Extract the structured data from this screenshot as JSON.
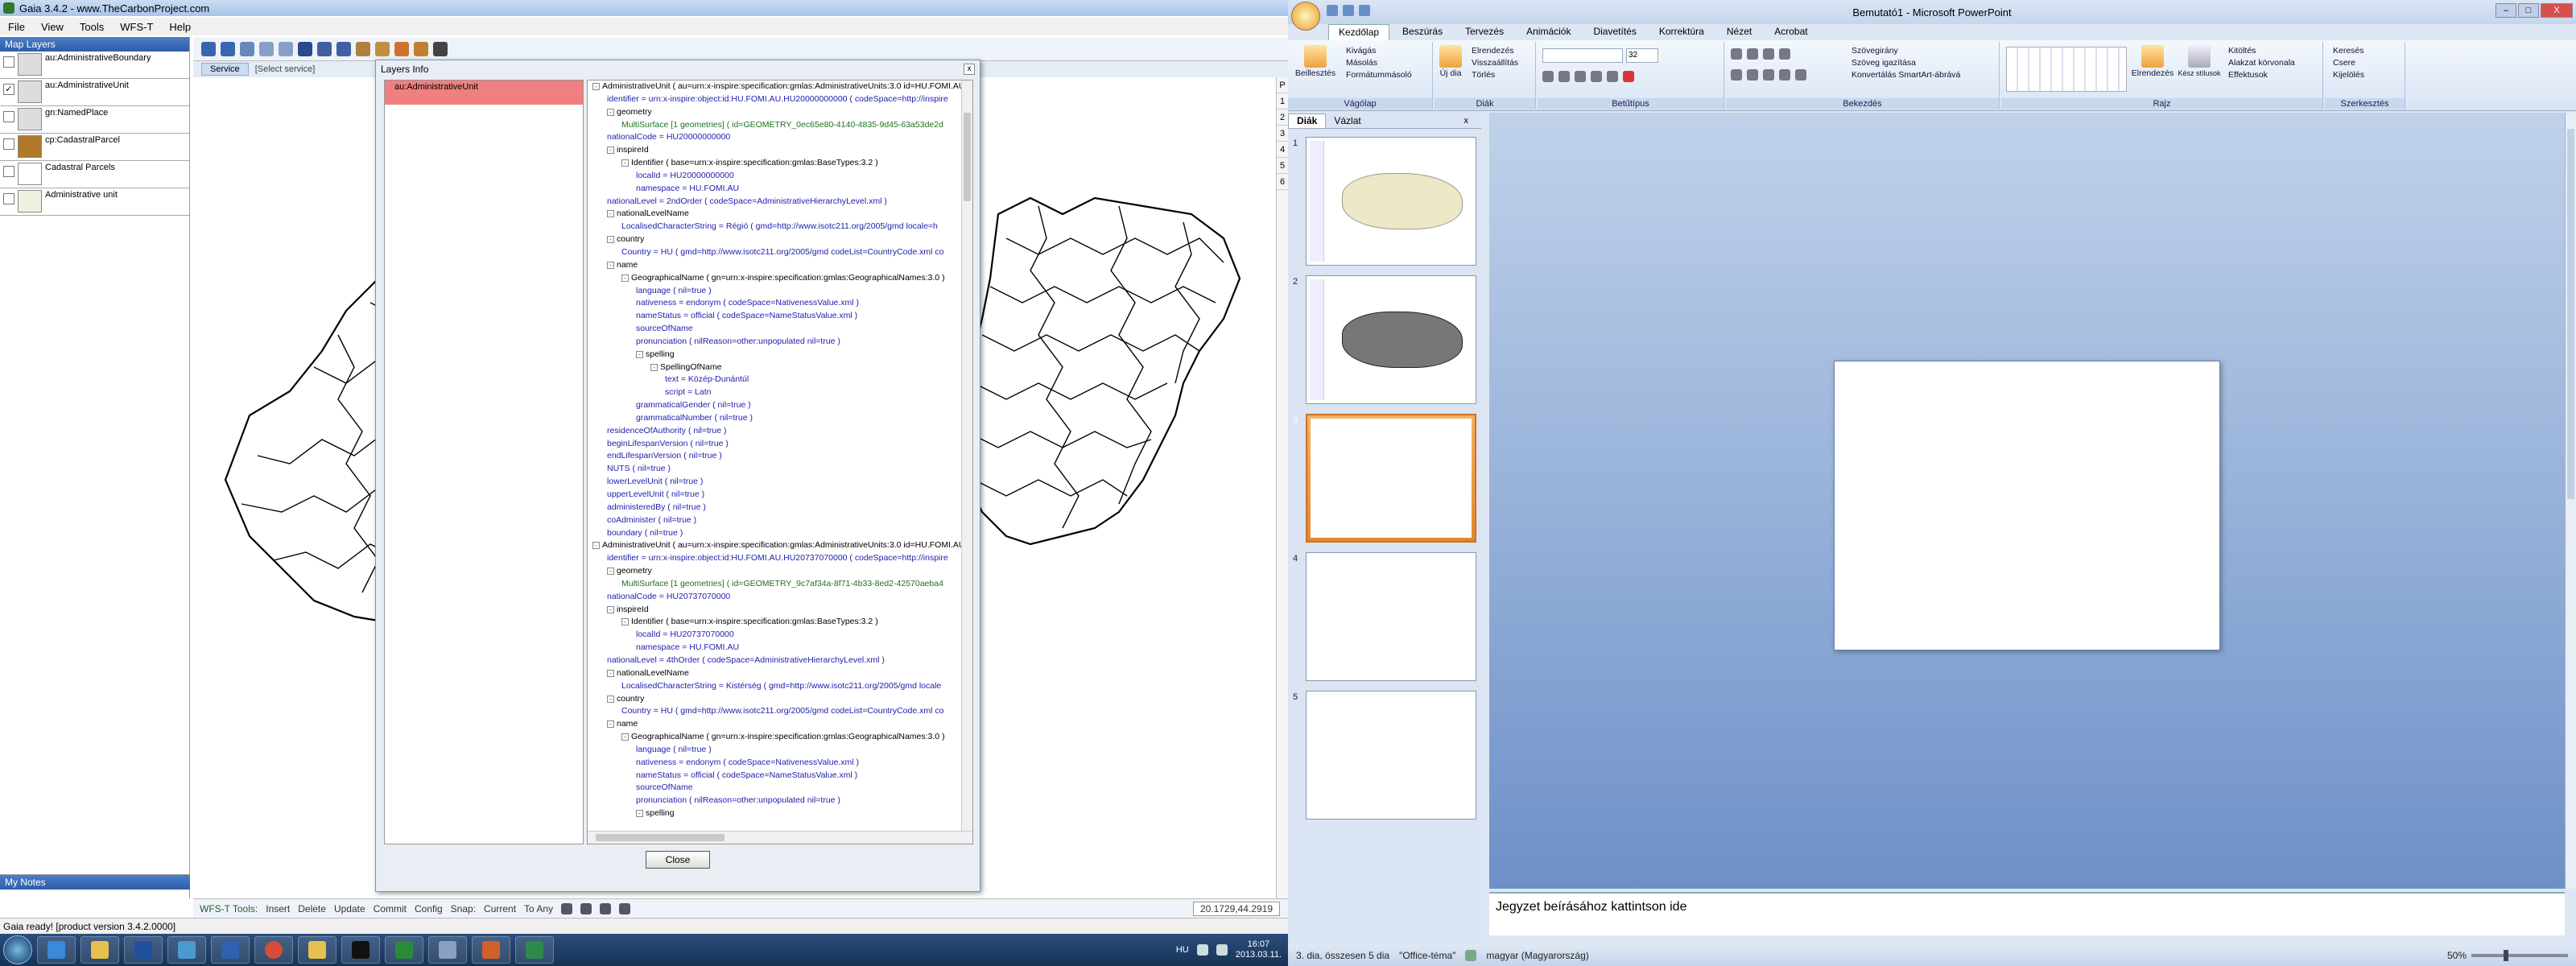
{
  "gaia": {
    "title": "Gaia 3.4.2 - www.TheCarbonProject.com",
    "menu": [
      "File",
      "View",
      "Tools",
      "WFS-T",
      "Help"
    ],
    "map_layers_header": "Map Layers",
    "layers": [
      {
        "name": "au:AdministrativeBoundary",
        "checked": false,
        "swatch": "#dddddd"
      },
      {
        "name": "au:AdministrativeUnit",
        "checked": true,
        "swatch": "#dddddd"
      },
      {
        "name": "gn:NamedPlace",
        "checked": false,
        "swatch": "#dddddd"
      },
      {
        "name": "cp:CadastralParcel",
        "checked": false,
        "swatch": "#b07a2a"
      },
      {
        "name": "Cadastral Parcels",
        "checked": false,
        "swatch": "#ffffff"
      },
      {
        "name": "Administrative unit",
        "checked": false,
        "swatch": "#f0f0e0"
      }
    ],
    "notes_header": "My Notes",
    "service_button": "Service",
    "service_placeholder": "[Select service]",
    "panel_numbers": [
      "P",
      "1",
      "2",
      "3",
      "4",
      "5",
      "6"
    ],
    "wfst": {
      "label": "WFS-T Tools:",
      "buttons": [
        "Insert",
        "Delete",
        "Update",
        "Commit",
        "Config"
      ],
      "snap": "Snap:",
      "snap_opts": [
        "Current",
        "To Any"
      ]
    },
    "coords": "20.1729,44.2919",
    "status": "Gaia ready! [product version 3.4.2.0000]"
  },
  "dialog": {
    "title": "Layers Info",
    "close_x": "x",
    "selected_layer": "au:AdministrativeUnit",
    "close_button": "Close",
    "tree": [
      {
        "lvl": 0,
        "pm": "-",
        "t": "AdministrativeUnit ( au=urn:x-inspire:specification:gmlas:AdministrativeUnits:3.0 id=HU.FOMI.AU.",
        "c": "n"
      },
      {
        "lvl": 1,
        "pm": "",
        "t": "identifier = urn:x-inspire:object:id:HU.FOMI.AU.HU20000000000 ( codeSpace=http://inspire",
        "c": "a"
      },
      {
        "lvl": 1,
        "pm": "-",
        "t": "geometry",
        "c": "n"
      },
      {
        "lvl": 2,
        "pm": "",
        "t": "MultiSurface [1 geometries]  ( id=GEOMETRY_0ec65e80-4140-4835-9d45-63a53de2d",
        "c": "g"
      },
      {
        "lvl": 1,
        "pm": "",
        "t": "nationalCode = HU20000000000",
        "c": "a"
      },
      {
        "lvl": 1,
        "pm": "-",
        "t": "inspireId",
        "c": "n"
      },
      {
        "lvl": 2,
        "pm": "-",
        "t": "Identifier ( base=urn:x-inspire:specification:gmlas:BaseTypes:3.2 )",
        "c": "n"
      },
      {
        "lvl": 3,
        "pm": "",
        "t": "localId = HU20000000000",
        "c": "a"
      },
      {
        "lvl": 3,
        "pm": "",
        "t": "namespace = HU.FOMI.AU",
        "c": "a"
      },
      {
        "lvl": 1,
        "pm": "",
        "t": "nationalLevel = 2ndOrder ( codeSpace=AdministrativeHierarchyLevel.xml )",
        "c": "a"
      },
      {
        "lvl": 1,
        "pm": "-",
        "t": "nationalLevelName",
        "c": "n"
      },
      {
        "lvl": 2,
        "pm": "",
        "t": "LocalisedCharacterString = Régió ( gmd=http://www.isotc211.org/2005/gmd locale=h",
        "c": "a"
      },
      {
        "lvl": 1,
        "pm": "-",
        "t": "country",
        "c": "n"
      },
      {
        "lvl": 2,
        "pm": "",
        "t": "Country = HU ( gmd=http://www.isotc211.org/2005/gmd codeList=CountryCode.xml co",
        "c": "a"
      },
      {
        "lvl": 1,
        "pm": "-",
        "t": "name",
        "c": "n"
      },
      {
        "lvl": 2,
        "pm": "-",
        "t": "GeographicalName ( gn=urn:x-inspire:specification:gmlas:GeographicalNames:3.0 )",
        "c": "n"
      },
      {
        "lvl": 3,
        "pm": "",
        "t": "language ( nil=true )",
        "c": "a"
      },
      {
        "lvl": 3,
        "pm": "",
        "t": "nativeness = endonym ( codeSpace=NativenessValue.xml )",
        "c": "a"
      },
      {
        "lvl": 3,
        "pm": "",
        "t": "nameStatus = official ( codeSpace=NameStatusValue.xml )",
        "c": "a"
      },
      {
        "lvl": 3,
        "pm": "",
        "t": "sourceOfName",
        "c": "a"
      },
      {
        "lvl": 3,
        "pm": "",
        "t": "pronunciation ( nilReason=other:unpopulated nil=true )",
        "c": "a"
      },
      {
        "lvl": 3,
        "pm": "-",
        "t": "spelling",
        "c": "n"
      },
      {
        "lvl": 4,
        "pm": "-",
        "t": "SpellingOfName",
        "c": "n"
      },
      {
        "lvl": 5,
        "pm": "",
        "t": "text = Közép-Dunántúl",
        "c": "a"
      },
      {
        "lvl": 5,
        "pm": "",
        "t": "script = Latn",
        "c": "a"
      },
      {
        "lvl": 3,
        "pm": "",
        "t": "grammaticalGender ( nil=true )",
        "c": "a"
      },
      {
        "lvl": 3,
        "pm": "",
        "t": "grammaticalNumber ( nil=true )",
        "c": "a"
      },
      {
        "lvl": 1,
        "pm": "",
        "t": "residenceOfAuthority ( nil=true )",
        "c": "a"
      },
      {
        "lvl": 1,
        "pm": "",
        "t": "beginLifespanVersion ( nil=true )",
        "c": "a"
      },
      {
        "lvl": 1,
        "pm": "",
        "t": "endLifespanVersion ( nil=true )",
        "c": "a"
      },
      {
        "lvl": 1,
        "pm": "",
        "t": "NUTS ( nil=true )",
        "c": "a"
      },
      {
        "lvl": 1,
        "pm": "",
        "t": "lowerLevelUnit ( nil=true )",
        "c": "a"
      },
      {
        "lvl": 1,
        "pm": "",
        "t": "upperLevelUnit ( nil=true )",
        "c": "a"
      },
      {
        "lvl": 1,
        "pm": "",
        "t": "administeredBy ( nil=true )",
        "c": "a"
      },
      {
        "lvl": 1,
        "pm": "",
        "t": "coAdminister ( nil=true )",
        "c": "a"
      },
      {
        "lvl": 1,
        "pm": "",
        "t": "boundary ( nil=true )",
        "c": "a"
      },
      {
        "lvl": 0,
        "pm": "-",
        "t": "AdministrativeUnit ( au=urn:x-inspire:specification:gmlas:AdministrativeUnits:3.0 id=HU.FOMI.AU.",
        "c": "n"
      },
      {
        "lvl": 1,
        "pm": "",
        "t": "identifier = urn:x-inspire:object:id:HU.FOMI.AU.HU20737070000 ( codeSpace=http://inspire",
        "c": "a"
      },
      {
        "lvl": 1,
        "pm": "-",
        "t": "geometry",
        "c": "n"
      },
      {
        "lvl": 2,
        "pm": "",
        "t": "MultiSurface [1 geometries]  ( id=GEOMETRY_9c7af34a-8f71-4b33-8ed2-42570aeba4",
        "c": "g"
      },
      {
        "lvl": 1,
        "pm": "",
        "t": "nationalCode = HU20737070000",
        "c": "a"
      },
      {
        "lvl": 1,
        "pm": "-",
        "t": "inspireId",
        "c": "n"
      },
      {
        "lvl": 2,
        "pm": "-",
        "t": "Identifier ( base=urn:x-inspire:specification:gmlas:BaseTypes:3.2 )",
        "c": "n"
      },
      {
        "lvl": 3,
        "pm": "",
        "t": "localId = HU20737070000",
        "c": "a"
      },
      {
        "lvl": 3,
        "pm": "",
        "t": "namespace = HU.FOMI.AU",
        "c": "a"
      },
      {
        "lvl": 1,
        "pm": "",
        "t": "nationalLevel = 4thOrder ( codeSpace=AdministrativeHierarchyLevel.xml )",
        "c": "a"
      },
      {
        "lvl": 1,
        "pm": "-",
        "t": "nationalLevelName",
        "c": "n"
      },
      {
        "lvl": 2,
        "pm": "",
        "t": "LocalisedCharacterString = Kistérség ( gmd=http://www.isotc211.org/2005/gmd locale",
        "c": "a"
      },
      {
        "lvl": 1,
        "pm": "-",
        "t": "country",
        "c": "n"
      },
      {
        "lvl": 2,
        "pm": "",
        "t": "Country = HU ( gmd=http://www.isotc211.org/2005/gmd codeList=CountryCode.xml co",
        "c": "a"
      },
      {
        "lvl": 1,
        "pm": "-",
        "t": "name",
        "c": "n"
      },
      {
        "lvl": 2,
        "pm": "-",
        "t": "GeographicalName ( gn=urn:x-inspire:specification:gmlas:GeographicalNames:3.0 )",
        "c": "n"
      },
      {
        "lvl": 3,
        "pm": "",
        "t": "language ( nil=true )",
        "c": "a"
      },
      {
        "lvl": 3,
        "pm": "",
        "t": "nativeness = endonym ( codeSpace=NativenessValue.xml )",
        "c": "a"
      },
      {
        "lvl": 3,
        "pm": "",
        "t": "nameStatus = official ( codeSpace=NameStatusValue.xml )",
        "c": "a"
      },
      {
        "lvl": 3,
        "pm": "",
        "t": "sourceOfName",
        "c": "a"
      },
      {
        "lvl": 3,
        "pm": "",
        "t": "pronunciation ( nilReason=other:unpopulated nil=true )",
        "c": "a"
      },
      {
        "lvl": 3,
        "pm": "-",
        "t": "spelling",
        "c": "n"
      }
    ]
  },
  "ppt": {
    "title": "Bemutató1 - Microsoft PowerPoint",
    "tabs": [
      "Kezdőlap",
      "Beszúrás",
      "Tervezés",
      "Animációk",
      "Diavetítés",
      "Korrektúra",
      "Nézet",
      "Acrobat"
    ],
    "groups": [
      {
        "label": "Vágólap",
        "items": [
          "Kivágás",
          "Másolás",
          "Formátummásoló"
        ],
        "big": "Beillesztés"
      },
      {
        "label": "Diák",
        "items": [
          "Elrendezés",
          "Visszaállítás",
          "Törlés"
        ],
        "big": "Új dia"
      },
      {
        "label": "Betűtípus",
        "items": [
          "32"
        ],
        "big": ""
      },
      {
        "label": "Bekezdés",
        "items": [
          "Szövegirány",
          "Szöveg igazítása",
          "Konvertálás SmartArt-ábrává"
        ],
        "big": ""
      },
      {
        "label": "Rajz",
        "items": [
          "Kitöltés",
          "Alakzat körvonala",
          "Effektusok"
        ],
        "big": "Elrendezés"
      },
      {
        "label": "Szerkesztés",
        "items": [
          "Keresés",
          "Csere",
          "Kijelölés"
        ],
        "big": ""
      }
    ],
    "quick_styles": "Kész stílusok",
    "panel_tabs": [
      "Diák",
      "Vázlat"
    ],
    "panel_close": "x",
    "slide_numbers": [
      "1",
      "2",
      "3",
      "4",
      "5"
    ],
    "notes_placeholder": "Jegyzet beírásához kattintson ide",
    "status": {
      "slide": "3. dia, összesen 5 dia",
      "theme": "\"Office-téma\"",
      "language": "magyar (Magyarország)",
      "zoom": "50%"
    },
    "win_buttons": [
      "–",
      "□",
      "X"
    ]
  },
  "taskbar": {
    "lang": "HU",
    "time": "16:07",
    "date": "2013.03.11."
  }
}
